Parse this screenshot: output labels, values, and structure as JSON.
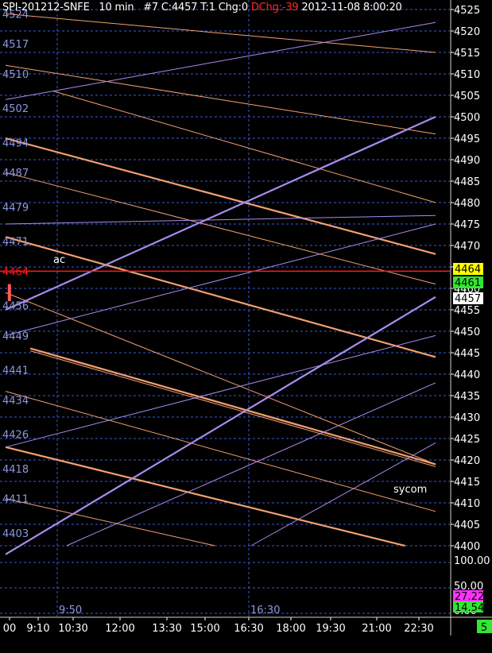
{
  "header": {
    "symbol": "SPI-201212-SNFE",
    "interval": "10 min",
    "bar_info": "#7 C:4457 T:1 Chg:0",
    "dchg": "DChg:-39",
    "datetime": "2012-11-08 8:00:20"
  },
  "colors": {
    "background": "#000000",
    "grid": "#3a5ad8",
    "axis_text": "#ffffff",
    "price_labels_left": "#8e98e0",
    "channel_orange": "#f4a070",
    "channel_purple": "#a88cf0",
    "current_price_line": "#ff1a1a",
    "tag_yellow": "#ffff00",
    "tag_green": "#32e632",
    "tag_white": "#ffffff",
    "tag_magenta": "#ff33ff"
  },
  "chart_data": {
    "type": "line",
    "title": "SPI-201212-SNFE 10 min",
    "ylim": [
      4397,
      4527
    ],
    "y_ticks_right": [
      4525,
      4520,
      4515,
      4510,
      4505,
      4500,
      4495,
      4490,
      4485,
      4480,
      4475,
      4470,
      4465,
      4460,
      4455,
      4450,
      4445,
      4440,
      4435,
      4430,
      4425,
      4420,
      4415,
      4410,
      4405,
      4400
    ],
    "y_labels_left": [
      4524,
      4517,
      4510,
      4502,
      4494,
      4487,
      4479,
      4471,
      4464,
      4456,
      4449,
      4441,
      4434,
      4426,
      4418,
      4411,
      4403
    ],
    "x_ticks": [
      "00",
      "9:10",
      "10:30",
      "12:00",
      "13:30",
      "15:00",
      "16:30",
      "18:00",
      "19:30",
      "21:00",
      "22:30"
    ],
    "session_markers": [
      "9:50",
      "16:30"
    ],
    "current_price": 4464,
    "current_price_label_left": "4464",
    "price_tags": [
      {
        "value": "4464",
        "color": "yellow"
      },
      {
        "value": "4461",
        "color": "green"
      },
      {
        "value": "4457",
        "color": "white"
      }
    ],
    "annotations": [
      "ac",
      "sycom"
    ],
    "trendlines": {
      "orange_thin": [
        {
          "t0": 0,
          "p0": 4524,
          "t1": 22.6,
          "p1": 4515
        },
        {
          "t0": 0,
          "p0": 4512,
          "t1": 22.6,
          "p1": 4496
        },
        {
          "t0": 2.5,
          "p0": 4506,
          "t1": 22.6,
          "p1": 4480
        },
        {
          "t0": 0,
          "p0": 4487,
          "t1": 22.6,
          "p1": 4461
        },
        {
          "t0": 0,
          "p0": 4459,
          "t1": 22.6,
          "p1": 4419
        },
        {
          "t0": 0,
          "p0": 4436,
          "t1": 22.6,
          "p1": 4408
        },
        {
          "t0": 0,
          "p0": 4411,
          "t1": 11.0,
          "p1": 4400
        }
      ],
      "orange_thick": [
        {
          "t0": 0,
          "p0": 4495,
          "t1": 22.6,
          "p1": 4468
        },
        {
          "t0": 0,
          "p0": 4472,
          "t1": 22.6,
          "p1": 4444
        },
        {
          "t0": 1.3,
          "p0": 4446,
          "t1": 22.6,
          "p1": 4419
        },
        {
          "t0": 0,
          "p0": 4423,
          "t1": 21.0,
          "p1": 4400
        }
      ],
      "purple_thin": [
        {
          "t0": 0,
          "p0": 4504,
          "t1": 22.6,
          "p1": 4522
        },
        {
          "t0": 0,
          "p0": 4475,
          "t1": 22.6,
          "p1": 4477
        },
        {
          "t0": 0,
          "p0": 4449,
          "t1": 22.6,
          "p1": 4475
        },
        {
          "t0": 0,
          "p0": 4423,
          "t1": 22.6,
          "p1": 4449
        },
        {
          "t0": 3.2,
          "p0": 4400,
          "t1": 22.6,
          "p1": 4438
        },
        {
          "t0": 12.9,
          "p0": 4400,
          "t1": 22.6,
          "p1": 4424
        }
      ],
      "purple_thick": [
        {
          "t0": 0,
          "p0": 4455,
          "t1": 22.6,
          "p1": 4500
        },
        {
          "t0": 0,
          "p0": 4398,
          "t1": 22.6,
          "p1": 4458
        }
      ]
    },
    "candle": {
      "t": 0.2,
      "open": 4461,
      "high": 4462,
      "low": 4457,
      "close": 4457
    },
    "indicator_pane": {
      "y_ticks": [
        "100.00",
        "50.00",
        "0.00"
      ],
      "tags": [
        {
          "value": "27.22",
          "color": "magenta"
        },
        {
          "value": "14.54",
          "color": "green"
        }
      ]
    },
    "corner_label": "5"
  }
}
